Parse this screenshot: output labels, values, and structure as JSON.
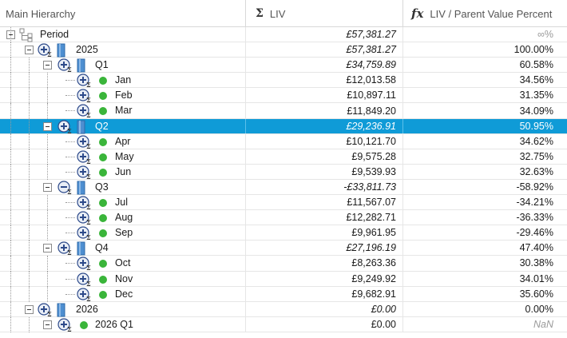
{
  "header": {
    "col1_label": "Main Hierarchy",
    "col2_icon": "Σ",
    "col2_label": "LIV",
    "col3_icon": "fx",
    "col3_label": "LIV / Parent Value Percent"
  },
  "colors": {
    "selected_row": "#0f9bd7",
    "leaf_dot": "#3ab53a",
    "cube_blue": "#4e8fd1"
  },
  "rows": [
    {
      "label": "Period",
      "liv": "£57,381.27",
      "pct": "∞%",
      "italic": true,
      "pct_muted": true
    },
    {
      "label": "2025",
      "liv": "£57,381.27",
      "pct": "100.00%",
      "italic": true
    },
    {
      "label": "Q1",
      "liv": "£34,759.89",
      "pct": "60.58%",
      "italic": true
    },
    {
      "label": "Jan",
      "liv": "£12,013.58",
      "pct": "34.56%"
    },
    {
      "label": "Feb",
      "liv": "£10,897.11",
      "pct": "31.35%"
    },
    {
      "label": "Mar",
      "liv": "£11,849.20",
      "pct": "34.09%"
    },
    {
      "label": "Q2",
      "liv": "£29,236.91",
      "pct": "50.95%",
      "italic": true,
      "selected": true
    },
    {
      "label": "Apr",
      "liv": "£10,121.70",
      "pct": "34.62%"
    },
    {
      "label": "May",
      "liv": "£9,575.28",
      "pct": "32.75%"
    },
    {
      "label": "Jun",
      "liv": "£9,539.93",
      "pct": "32.63%"
    },
    {
      "label": "Q3",
      "liv": "-£33,811.73",
      "pct": "-58.92%",
      "italic": true
    },
    {
      "label": "Jul",
      "liv": "£11,567.07",
      "pct": "-34.21%"
    },
    {
      "label": "Aug",
      "liv": "£12,282.71",
      "pct": "-36.33%"
    },
    {
      "label": "Sep",
      "liv": "£9,961.95",
      "pct": "-29.46%"
    },
    {
      "label": "Q4",
      "liv": "£27,196.19",
      "pct": "47.40%",
      "italic": true
    },
    {
      "label": "Oct",
      "liv": "£8,263.36",
      "pct": "30.38%"
    },
    {
      "label": "Nov",
      "liv": "£9,249.92",
      "pct": "34.01%"
    },
    {
      "label": "Dec",
      "liv": "£9,682.91",
      "pct": "35.60%"
    },
    {
      "label": "2026",
      "liv": "£0.00",
      "pct": "0.00%",
      "italic": true
    },
    {
      "label": "2026 Q1",
      "liv": "£0.00",
      "pct": "NaN",
      "pct_muted": true,
      "pct_italic": true
    }
  ]
}
